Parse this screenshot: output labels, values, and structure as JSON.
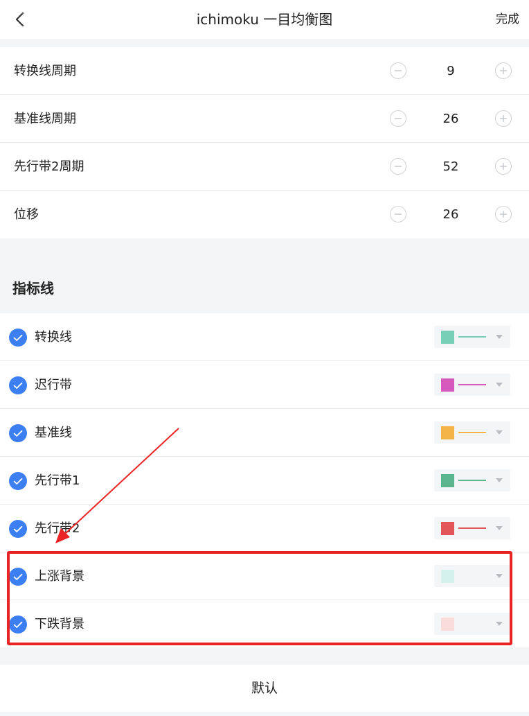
{
  "header": {
    "title": "ichimoku 一目均衡图",
    "done_label": "完成"
  },
  "params": [
    {
      "label": "转换线周期",
      "value": "9"
    },
    {
      "label": "基准线周期",
      "value": "26"
    },
    {
      "label": "先行带2周期",
      "value": "52"
    },
    {
      "label": "位移",
      "value": "26"
    }
  ],
  "lines_section": {
    "title": "指标线",
    "items": [
      {
        "label": "转换线",
        "checked": true,
        "color": "#76d0b6",
        "line_color": "#76d0b6",
        "show_line": true
      },
      {
        "label": "迟行带",
        "checked": true,
        "color": "#d659be",
        "line_color": "#d659be",
        "show_line": true
      },
      {
        "label": "基准线",
        "checked": true,
        "color": "#f3b347",
        "line_color": "#f3b347",
        "show_line": true
      },
      {
        "label": "先行带1",
        "checked": true,
        "color": "#5bb68f",
        "line_color": "#5bb68f",
        "show_line": true
      },
      {
        "label": "先行带2",
        "checked": true,
        "color": "#e25559",
        "line_color": "#e25559",
        "show_line": true
      },
      {
        "label": "上涨背景",
        "checked": true,
        "color": "#d4f1ec",
        "line_color": "",
        "show_line": false
      },
      {
        "label": "下跌背景",
        "checked": true,
        "color": "#fadcdc",
        "line_color": "",
        "show_line": false
      }
    ]
  },
  "footer": {
    "default_label": "默认"
  },
  "colors": {
    "accent": "#3b7ff2",
    "highlight": "#ea2424"
  },
  "icons": {
    "back": "chevron-left-icon",
    "minus": "minus-circle-icon",
    "plus": "plus-circle-icon",
    "check": "check-circle-icon",
    "caret": "caret-down-icon"
  }
}
